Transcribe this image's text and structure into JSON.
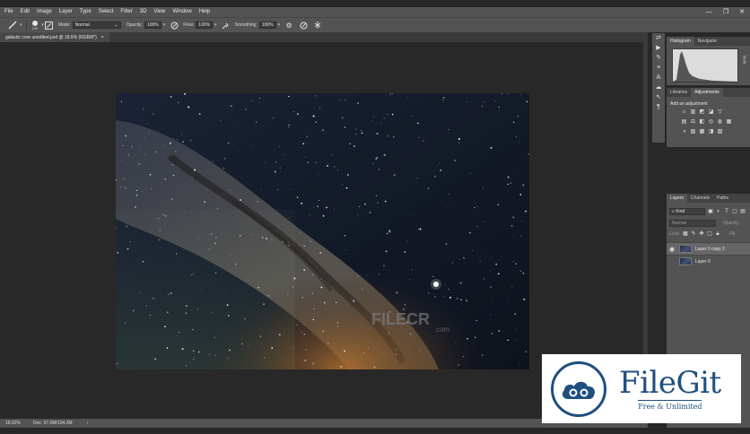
{
  "menu": {
    "items": [
      "File",
      "Edit",
      "Image",
      "Layer",
      "Type",
      "Select",
      "Filter",
      "3D",
      "View",
      "Window",
      "Help"
    ],
    "minimize": "—",
    "restore": "❐",
    "close": "✕"
  },
  "options_bar": {
    "brush_size": "100",
    "mode_label": "Mode:",
    "mode_value": "Normal",
    "opacity_label": "Opacity:",
    "opacity_value": "100%",
    "flow_label": "Flow:",
    "flow_value": "100%",
    "smoothing_label": "Smoothing:",
    "smoothing_value": "100%"
  },
  "document": {
    "tab_title": "galactic core unedited.psd @ 18.6% (RGB/8*)",
    "tab_close": "×",
    "watermark_text": "FILECR",
    "watermark_sub": ".com"
  },
  "status_bar": {
    "zoom": "18.62%",
    "doc_info": "Doc: 57.0M/104.2M",
    "arrow": "›"
  },
  "panels": {
    "histogram_tab": "Histogram",
    "navigator_tab": "Navigator",
    "libraries_tab": "Libraries",
    "adjustments_tab": "Adjustments",
    "adjustments_title": "Add an adjustment",
    "layers_tab": "Layers",
    "channels_tab": "Channels",
    "paths_tab": "Paths",
    "kind_value": "Kind",
    "blend_mode": "Normal",
    "opacity_label": "Opacity:",
    "lock_label": "Lock:",
    "fill_label": "Fill:",
    "layers": [
      {
        "name": "Layer 0 copy 2",
        "visible": true
      },
      {
        "name": "Layer 0",
        "visible": false
      }
    ]
  },
  "branding": {
    "name": "FileGit",
    "tagline": "Free & Unlimited",
    "color": "#1f4f80"
  }
}
